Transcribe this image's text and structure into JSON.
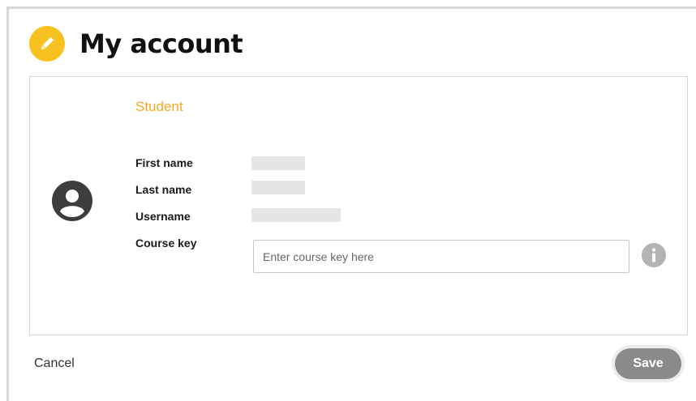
{
  "header": {
    "title": "My account",
    "icon": "pencil-icon",
    "accent_color": "#f7c221"
  },
  "profile": {
    "avatar_icon": "user-avatar-icon",
    "role": "Student",
    "role_color": "#f5a623",
    "fields": {
      "first_name_label": "First name",
      "last_name_label": "Last name",
      "username_label": "Username",
      "course_key_label": "Course key"
    },
    "course_key": {
      "value": "",
      "placeholder": "Enter course key here"
    },
    "info_icon": "info-icon"
  },
  "footer": {
    "cancel_label": "Cancel",
    "save_label": "Save"
  }
}
